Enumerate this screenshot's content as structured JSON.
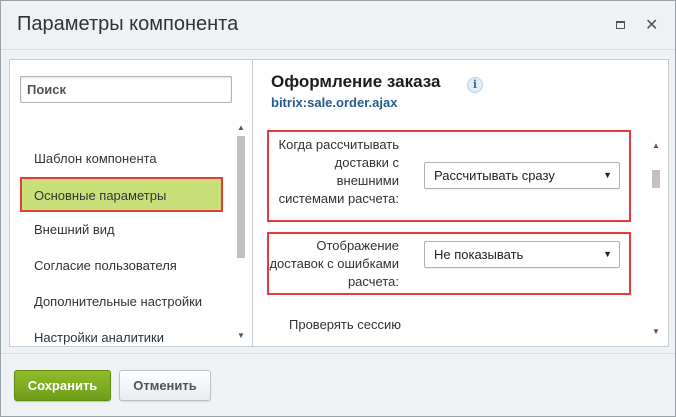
{
  "dialog": {
    "title": "Параметры компонента",
    "maximize_icon": "maximize-icon",
    "close_icon": "close-icon"
  },
  "sidebar": {
    "search_placeholder": "Поиск",
    "items": [
      {
        "label": "Шаблон компонента"
      },
      {
        "label": "Основные параметры"
      },
      {
        "label": "Внешний вид"
      },
      {
        "label": "Согласие пользователя"
      },
      {
        "label": "Дополнительные настройки"
      },
      {
        "label": "Настройки аналитики"
      }
    ],
    "active_index": 1
  },
  "panel": {
    "title": "Оформление заказа",
    "info_icon": "i",
    "component_code": "bitrix:sale.order.ajax",
    "params": [
      {
        "label": "Когда рассчитывать доставки с внешними системами расчета:",
        "value": "Рассчитывать сразу"
      },
      {
        "label": "Отображение доставок с ошибками расчета:",
        "value": "Не показывать"
      },
      {
        "label": "Проверять сессию"
      }
    ]
  },
  "footer": {
    "save_label": "Сохранить",
    "cancel_label": "Отменить"
  },
  "colors": {
    "highlight_border": "#e53b3b",
    "active_item_bg": "#c9e07a",
    "save_button": "#7aa81f",
    "link": "#265c8f"
  }
}
